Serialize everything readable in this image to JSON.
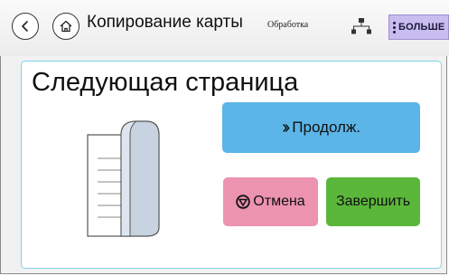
{
  "header": {
    "title": "Копирование карты",
    "subtitle": "Обработка",
    "more_label": "БОЛЬШЕ"
  },
  "main": {
    "heading": "Следующая страница",
    "continue_label": "Продолж.",
    "cancel_label": "Отмена",
    "finish_label": "Завершить"
  },
  "icons": {
    "back": "back-arrow-icon",
    "home": "home-icon",
    "network": "network-icon",
    "more": "vertical-dots-icon",
    "continue": "double-chevron-right-icon",
    "cancel": "stop-icon",
    "illustration": "document-page-turn-icon"
  },
  "colors": {
    "continue": "#5bb5e7",
    "cancel": "#ec93b0",
    "finish": "#5bb73a",
    "more": "#c9bcef",
    "panel_border": "#7fd3ee"
  }
}
